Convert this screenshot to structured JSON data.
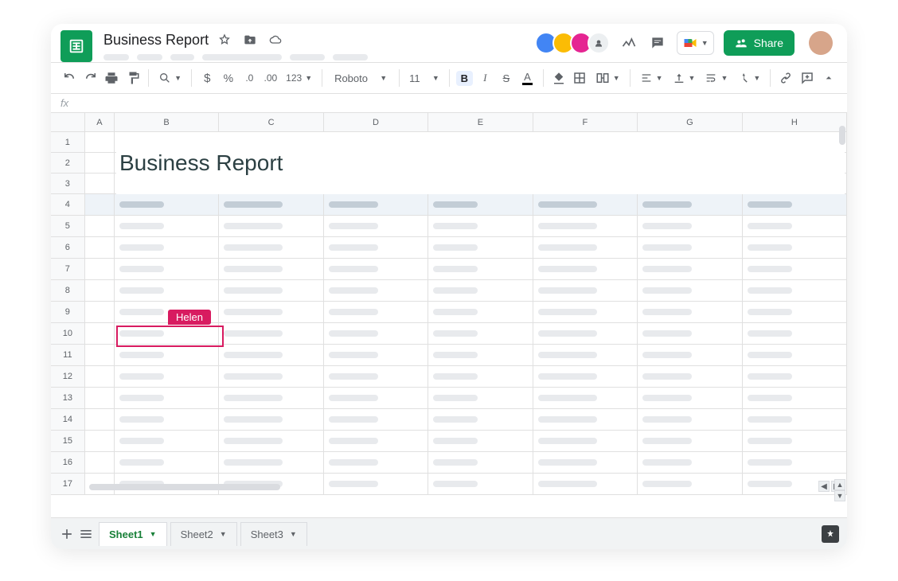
{
  "doc": {
    "title": "Business Report"
  },
  "toolbar": {
    "font": "Roboto",
    "font_size": "11"
  },
  "share": {
    "label": "Share"
  },
  "collaborator": {
    "name": "Helen"
  },
  "sheet": {
    "columns": [
      "A",
      "B",
      "C",
      "D",
      "E",
      "F",
      "G",
      "H"
    ],
    "rows_visible": 17,
    "title_text": "Business Report"
  },
  "tabs": [
    "Sheet1",
    "Sheet2",
    "Sheet3"
  ],
  "active_tab": "Sheet1"
}
